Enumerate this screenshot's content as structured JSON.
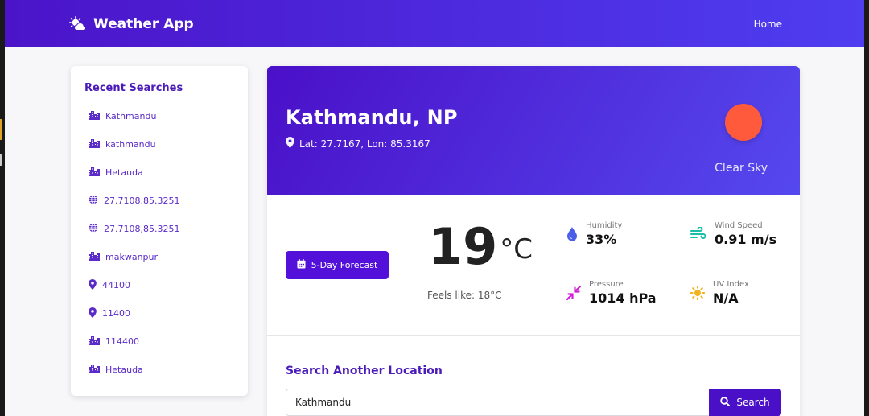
{
  "navbar": {
    "brand": "Weather App",
    "brand_icon": "cloud-sun-icon",
    "home_link": "Home"
  },
  "sidebar": {
    "title": "Recent Searches",
    "items": [
      {
        "label": "Kathmandu",
        "icon": "city-icon"
      },
      {
        "label": "kathmandu",
        "icon": "city-icon"
      },
      {
        "label": "Hetauda",
        "icon": "city-icon"
      },
      {
        "label": "27.7108,85.3251",
        "icon": "globe-icon"
      },
      {
        "label": "27.7108,85.3251",
        "icon": "globe-icon"
      },
      {
        "label": "makwanpur",
        "icon": "city-icon"
      },
      {
        "label": "44100",
        "icon": "map-pin-icon"
      },
      {
        "label": "11400",
        "icon": "map-pin-icon"
      },
      {
        "label": "114400",
        "icon": "city-icon"
      },
      {
        "label": "Hetauda",
        "icon": "city-icon"
      }
    ]
  },
  "weather": {
    "location": "Kathmandu, NP",
    "coordinates": "Lat: 27.7167, Lon: 85.3167",
    "condition": "Clear Sky",
    "temperature": "19",
    "unit": "°C",
    "feels_like": "Feels like: 18°C",
    "forecast_button": "5-Day Forecast",
    "metrics": {
      "humidity": {
        "label": "Humidity",
        "value": "33%",
        "icon": "droplet-icon"
      },
      "wind": {
        "label": "Wind Speed",
        "value": "0.91 m/s",
        "icon": "wind-icon"
      },
      "pressure": {
        "label": "Pressure",
        "value": "1014 hPa",
        "icon": "compress-icon"
      },
      "uv": {
        "label": "UV Index",
        "value": "N/A",
        "icon": "sun-icon"
      }
    }
  },
  "search": {
    "title": "Search Another Location",
    "value": "Kathmandu",
    "button": "Search"
  },
  "colors": {
    "primary": "#4a10c8",
    "accent": "#5548ee",
    "sun": "#ff5a3c",
    "humidity_icon": "#4a5ee8",
    "wind_icon": "#1bbfa8",
    "pressure_icon": "#d21fd8",
    "uv_icon": "#f2b320"
  }
}
